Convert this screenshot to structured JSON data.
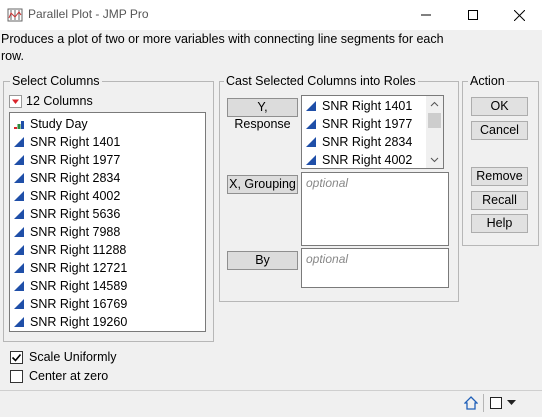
{
  "window": {
    "title": "Parallel Plot - JMP Pro"
  },
  "description": "Produces a plot of two or more variables with connecting line segments for each row.",
  "select_columns": {
    "legend": "Select Columns",
    "count_label": "12 Columns",
    "items": [
      {
        "name": "Study Day",
        "type": "nominal"
      },
      {
        "name": "SNR Right 1401",
        "type": "continuous"
      },
      {
        "name": "SNR Right 1977",
        "type": "continuous"
      },
      {
        "name": "SNR Right 2834",
        "type": "continuous"
      },
      {
        "name": "SNR Right 4002",
        "type": "continuous"
      },
      {
        "name": "SNR Right 5636",
        "type": "continuous"
      },
      {
        "name": "SNR Right 7988",
        "type": "continuous"
      },
      {
        "name": "SNR Right 11288",
        "type": "continuous"
      },
      {
        "name": "SNR Right 12721",
        "type": "continuous"
      },
      {
        "name": "SNR Right 14589",
        "type": "continuous"
      },
      {
        "name": "SNR Right 16769",
        "type": "continuous"
      },
      {
        "name": "SNR Right 19260",
        "type": "continuous"
      }
    ]
  },
  "cast_roles": {
    "legend": "Cast Selected Columns into Roles",
    "y_response": {
      "button": "Y, Response",
      "items": [
        "SNR Right 1401",
        "SNR Right 1977",
        "SNR Right 2834",
        "SNR Right 4002"
      ]
    },
    "x_grouping": {
      "button": "X, Grouping",
      "placeholder": "optional"
    },
    "by": {
      "button": "By",
      "placeholder": "optional"
    }
  },
  "action": {
    "legend": "Action",
    "ok": "OK",
    "cancel": "Cancel",
    "remove": "Remove",
    "recall": "Recall",
    "help": "Help"
  },
  "options": {
    "scale_uniformly": {
      "label": "Scale Uniformly",
      "checked": true
    },
    "center_at_zero": {
      "label": "Center at zero",
      "checked": false
    }
  },
  "colors": {
    "continuous_icon": "#1f4fa8",
    "menu_red": "#d9242b"
  },
  "icons": {
    "minimize": "minimize-icon",
    "maximize": "maximize-icon",
    "close": "close-icon"
  }
}
